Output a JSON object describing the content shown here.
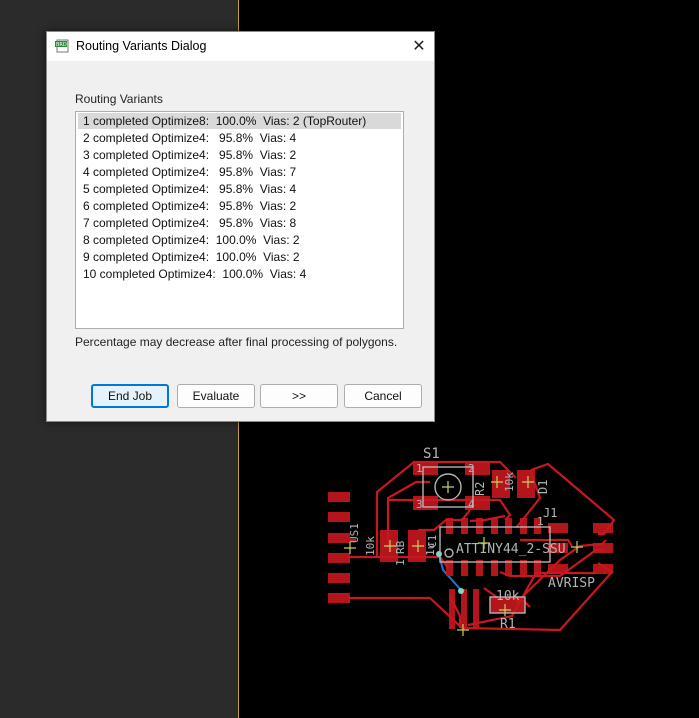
{
  "dialog": {
    "title": "Routing Variants Dialog",
    "icon": "brd-file-icon",
    "close_symbol": "✕",
    "group_label": "Routing Variants",
    "variants": [
      {
        "text": "1 completed Optimize8:  100.0%  Vias: 2 (TopRouter)",
        "selected": true
      },
      {
        "text": "2 completed Optimize4:   95.8%  Vias: 4",
        "selected": false
      },
      {
        "text": "3 completed Optimize4:   95.8%  Vias: 2",
        "selected": false
      },
      {
        "text": "4 completed Optimize4:   95.8%  Vias: 7",
        "selected": false
      },
      {
        "text": "5 completed Optimize4:   95.8%  Vias: 4",
        "selected": false
      },
      {
        "text": "6 completed Optimize4:   95.8%  Vias: 2",
        "selected": false
      },
      {
        "text": "7 completed Optimize4:   95.8%  Vias: 8",
        "selected": false
      },
      {
        "text": "8 completed Optimize4:  100.0%  Vias: 2",
        "selected": false
      },
      {
        "text": "9 completed Optimize4:  100.0%  Vias: 2",
        "selected": false
      },
      {
        "text": "10 completed Optimize4:  100.0%  Vias: 4",
        "selected": false
      }
    ],
    "note": "Percentage may decrease after final processing of polygons.",
    "buttons": {
      "end_job": "End Job",
      "evaluate": "Evaluate",
      "next": ">>",
      "cancel": "Cancel"
    }
  },
  "board": {
    "labels": {
      "s1": "S1",
      "r2": "R2",
      "r2_value": "10k",
      "d1": "D1",
      "j1": "J1",
      "j1_pin": "1",
      "ic": "ATTINY44_2-SSU",
      "us1": "US1",
      "r_10k": "10k",
      "r_1": "1",
      "rb": "RB",
      "c1": "C1",
      "c1_val": "1u",
      "avrisp": "AVRISP",
      "r1_value": "10k",
      "r1": "R1",
      "sw_pin1": "1",
      "sw_pin2": "2",
      "sw_pin3": "3",
      "sw_pin4": "4"
    },
    "colors": {
      "copper": "#c8171e",
      "trace": "#c8171e",
      "silk": "#b4b4b4",
      "bottom_trace": "#1e78d2",
      "origin": "#c8d060",
      "via": "#7fd7c0"
    }
  }
}
